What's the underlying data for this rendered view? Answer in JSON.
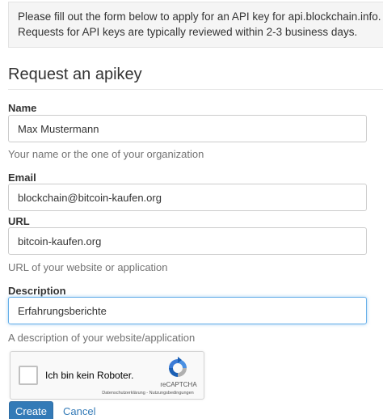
{
  "info": {
    "line1": "Please fill out the form below to apply for an API key for api.blockchain.info.",
    "line2": "Requests for API keys are typically reviewed within 2-3 business days."
  },
  "form": {
    "legend": "Request an apikey",
    "name": {
      "label": "Name",
      "value": "Max Mustermann",
      "help": "Your name or the one of your organization"
    },
    "email": {
      "label": "Email",
      "value": "blockchain@bitcoin-kaufen.org"
    },
    "url": {
      "label": "URL",
      "value": "bitcoin-kaufen.org",
      "help": "URL of your website or application"
    },
    "description": {
      "label": "Description",
      "value": "Erfahrungsberichte",
      "help": "A description of your website/application"
    }
  },
  "captcha": {
    "checkbox_label": "Ich bin kein Roboter.",
    "brand": "reCAPTCHA",
    "links": "Datenschutzerklärung - Nutzungsbedingungen",
    "checked": false
  },
  "actions": {
    "create_label": "Create",
    "cancel_label": "Cancel"
  },
  "colors": {
    "primary": "#337ab7",
    "focus_border": "#66afe9",
    "info_background": "#f5f5f5"
  }
}
